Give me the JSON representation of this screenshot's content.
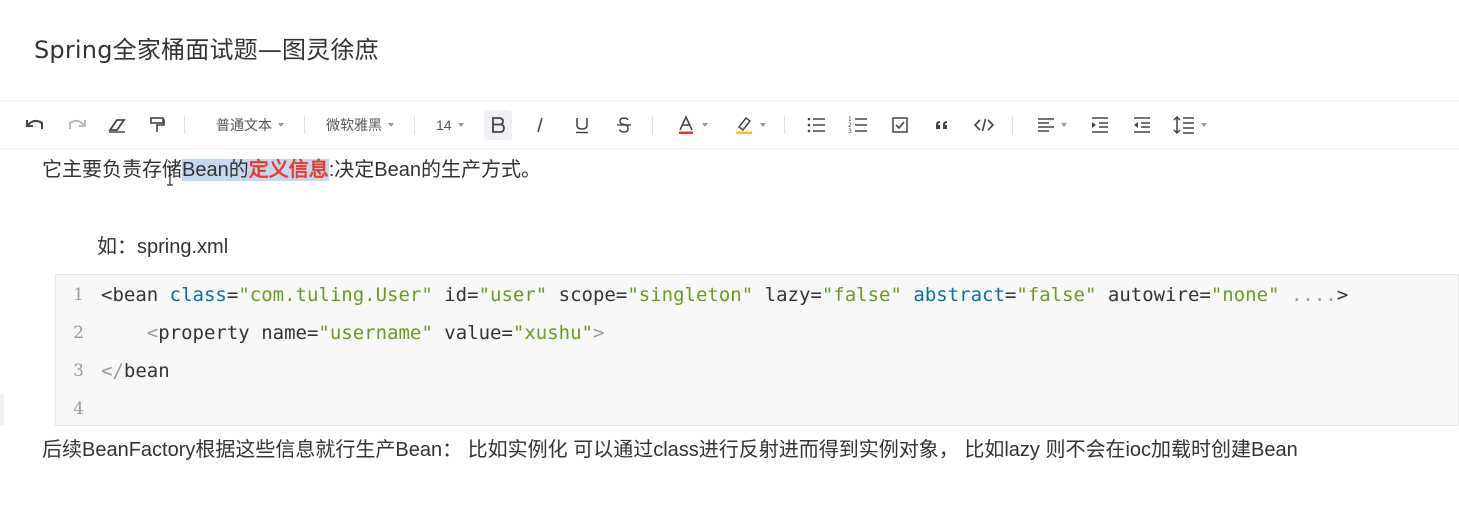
{
  "document": {
    "title": "Spring全家桶面试题—图灵徐庶"
  },
  "toolbar": {
    "paragraph_style": "普通文本",
    "font_family": "微软雅黑",
    "font_size": "14"
  },
  "content": {
    "para1": {
      "before": "它主要负责存储",
      "highlight_plain": "Bean的",
      "highlight_red": "定义信息",
      "after": ":决定Bean的生产方式。"
    },
    "para2": "如：spring.xml",
    "code": {
      "line_numbers": [
        "1",
        "2",
        "3",
        "4"
      ],
      "line1": {
        "open": "<bean",
        "attr_class": "class",
        "val_class": "\"com.tuling.User\"",
        "attr_id": "id",
        "val_id": "\"user\"",
        "attr_scope": "scope",
        "val_scope": "\"singleton\"",
        "attr_lazy": "lazy",
        "val_lazy": "\"false\"",
        "attr_abstract": "abstract",
        "val_abstract": "\"false\"",
        "attr_autowire": "autowire",
        "val_autowire": "\"none\"",
        "ellipsis": "....",
        "close": ">"
      },
      "line2": {
        "open_lt": "<",
        "tag": "property",
        "attr_name": "name",
        "val_name": "\"username\"",
        "attr_value": "value",
        "val_value": "\"xushu\"",
        "close": ">"
      },
      "line3": {
        "open_lt": "</",
        "tag": "bean"
      }
    },
    "para3": "后续BeanFactory根据这些信息就行生产Bean： 比如实例化  可以通过class进行反射进而得到实例对象， 比如lazy  则不会在ioc加载时创建Bean"
  }
}
